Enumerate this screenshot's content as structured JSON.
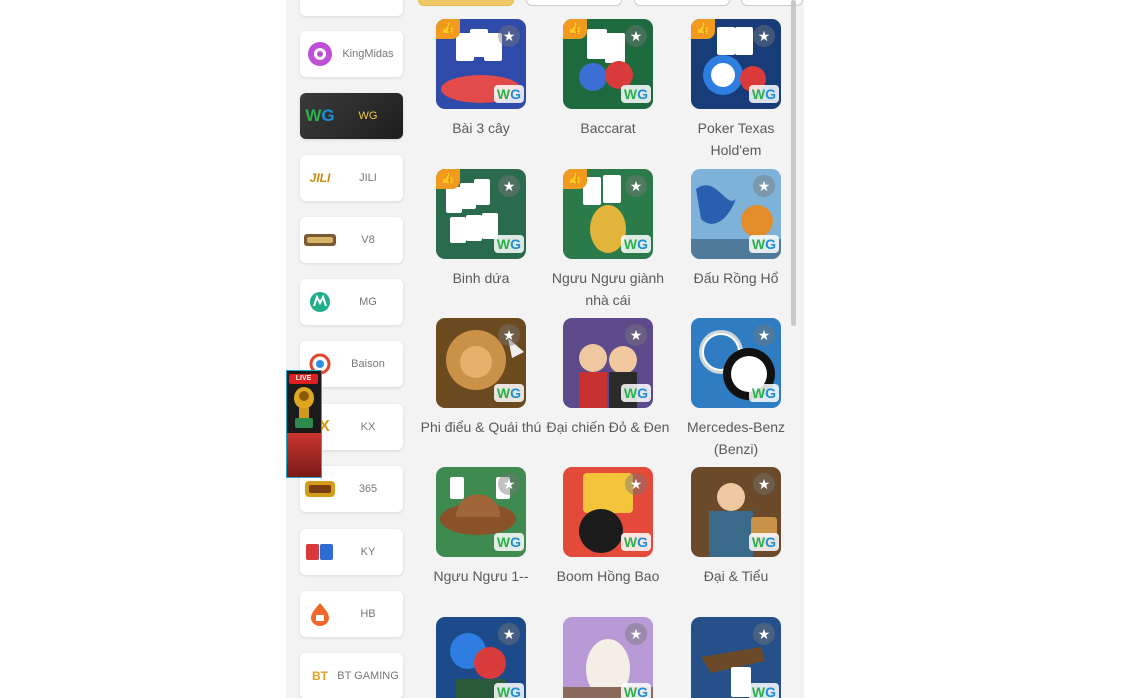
{
  "providers": [
    {
      "label": "KingMidas",
      "icon": "kingmidas-logo-icon"
    },
    {
      "label": "WG",
      "icon": "wg-logo-icon",
      "active": true
    },
    {
      "label": "JILI",
      "icon": "jili-logo-icon"
    },
    {
      "label": "V8",
      "icon": "v8-logo-icon"
    },
    {
      "label": "MG",
      "icon": "mg-logo-icon"
    },
    {
      "label": "Baison",
      "icon": "baison-logo-icon"
    },
    {
      "label": "KX",
      "icon": "kx-logo-icon"
    },
    {
      "label": "365",
      "icon": "365-logo-icon"
    },
    {
      "label": "KY",
      "icon": "ky-logo-icon"
    },
    {
      "label": "HB",
      "icon": "hb-logo-icon"
    },
    {
      "label": "BT GAMING",
      "icon": "bt-gaming-logo-icon"
    }
  ],
  "live_widget": {
    "badge": "LIVE"
  },
  "games": [
    {
      "name": "Bài 3 cây",
      "hot": true
    },
    {
      "name": "Baccarat",
      "hot": true
    },
    {
      "name": "Poker Texas Hold'em",
      "hot": true
    },
    {
      "name": "Binh dứa",
      "hot": true
    },
    {
      "name": "Ngưu Ngưu giành nhà cái",
      "hot": true
    },
    {
      "name": "Đấu Rồng Hổ",
      "hot": false
    },
    {
      "name": "Phi điểu & Quái thú",
      "hot": false
    },
    {
      "name": "Đại chiến Đỏ & Đen",
      "hot": false
    },
    {
      "name": "Mercedes-Benz (Benzi)",
      "hot": false
    },
    {
      "name": "Ngưu Ngưu 1--",
      "hot": false
    },
    {
      "name": "Boom Hồng Bao",
      "hot": false
    },
    {
      "name": "Đại & Tiểu",
      "hot": false
    },
    {
      "name": "",
      "hot": false
    },
    {
      "name": "",
      "hot": false
    },
    {
      "name": "",
      "hot": false
    }
  ],
  "colors": {
    "accent_tab": "#f0c766",
    "hot_badge": "#f19a1d",
    "wg_green": "#2bb24c",
    "wg_blue": "#1c8fd9"
  }
}
